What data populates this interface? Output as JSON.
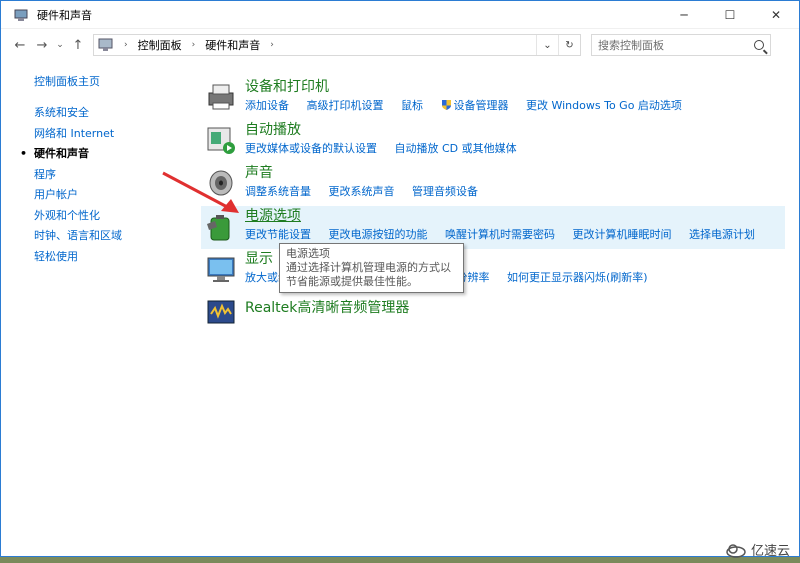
{
  "window": {
    "title": "硬件和声音",
    "minimize": "─",
    "maximize": "☐",
    "close": "✕"
  },
  "nav": {
    "back": "←",
    "forward": "→",
    "down": "⌄",
    "up": "↑"
  },
  "address": {
    "seg1": "控制面板",
    "sep1": "›",
    "seg2": "硬件和声音",
    "sep2": "›",
    "dropdown": "⌄",
    "refresh": "↻"
  },
  "search": {
    "placeholder": "搜索控制面板"
  },
  "sidebar": {
    "home": "控制面板主页",
    "items": [
      {
        "label": "系统和安全"
      },
      {
        "label": "网络和 Internet"
      },
      {
        "label": "硬件和声音"
      },
      {
        "label": "程序"
      },
      {
        "label": "用户帐户"
      },
      {
        "label": "外观和个性化"
      },
      {
        "label": "时钟、语言和区域"
      },
      {
        "label": "轻松使用"
      }
    ]
  },
  "categories": {
    "devices": {
      "title": "设备和打印机",
      "links": [
        "添加设备",
        "高级打印机设置",
        "鼠标",
        "设备管理器",
        "更改 Windows To Go 启动选项"
      ]
    },
    "autoplay": {
      "title": "自动播放",
      "links": [
        "更改媒体或设备的默认设置",
        "自动播放 CD 或其他媒体"
      ]
    },
    "sound": {
      "title": "声音",
      "links": [
        "调整系统音量",
        "更改系统声音",
        "管理音频设备"
      ]
    },
    "power": {
      "title": "电源选项",
      "links": [
        "更改节能设置",
        "更改电源按钮的功能",
        "唤醒计算机时需要密码",
        "更改计算机睡眠时间",
        "选择电源计划"
      ]
    },
    "display": {
      "title": "显示",
      "links": [
        "放大或缩小文本和其他项目",
        "调整屏幕分辨率",
        "如何更正显示器闪烁(刷新率)"
      ],
      "link1_short": "放大或"
    },
    "realtek": {
      "title": "Realtek高清晰音频管理器"
    }
  },
  "tooltip": {
    "title": "电源选项",
    "body": "通过选择计算机管理电源的方式以节省能源或提供最佳性能。"
  },
  "watermark": {
    "text": "亿速云"
  }
}
